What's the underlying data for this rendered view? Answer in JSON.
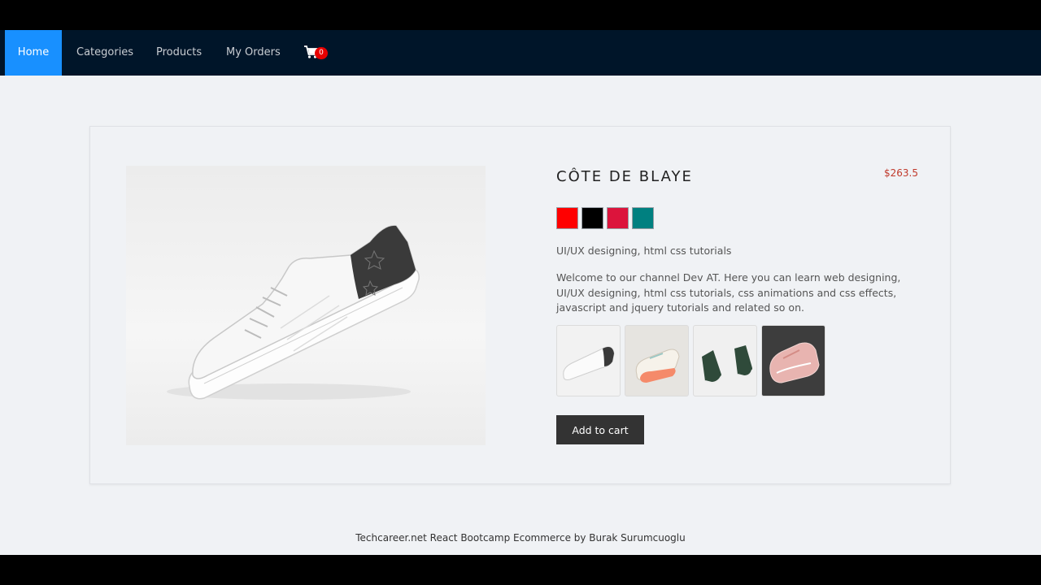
{
  "nav": {
    "items": [
      {
        "label": "Home",
        "active": true
      },
      {
        "label": "Categories",
        "active": false
      },
      {
        "label": "Products",
        "active": false
      },
      {
        "label": "My Orders",
        "active": false
      }
    ],
    "cart": {
      "icon": "shopping-cart-icon",
      "count": "0"
    }
  },
  "colors": {
    "navbar": "#001529",
    "active_tab": "#1890ff",
    "price": "#c0392b",
    "badge": "#e60000"
  },
  "product": {
    "title": "CÔTE DE BLAYE",
    "price": "$263.5",
    "swatches": [
      "#ff0000",
      "#000000",
      "#dc143c",
      "#008080"
    ],
    "subtitle": "UI/UX designing, html css tutorials",
    "description": "Welcome to our channel Dev AT. Here you can learn web designing, UI/UX designing, html css tutorials, css animations and css effects, javascript and jquery tutorials and related so on.",
    "add_to_cart_label": "Add to cart"
  },
  "footer": {
    "text": "Techcareer.net React Bootcamp Ecommerce by Burak Surumcuoglu"
  }
}
